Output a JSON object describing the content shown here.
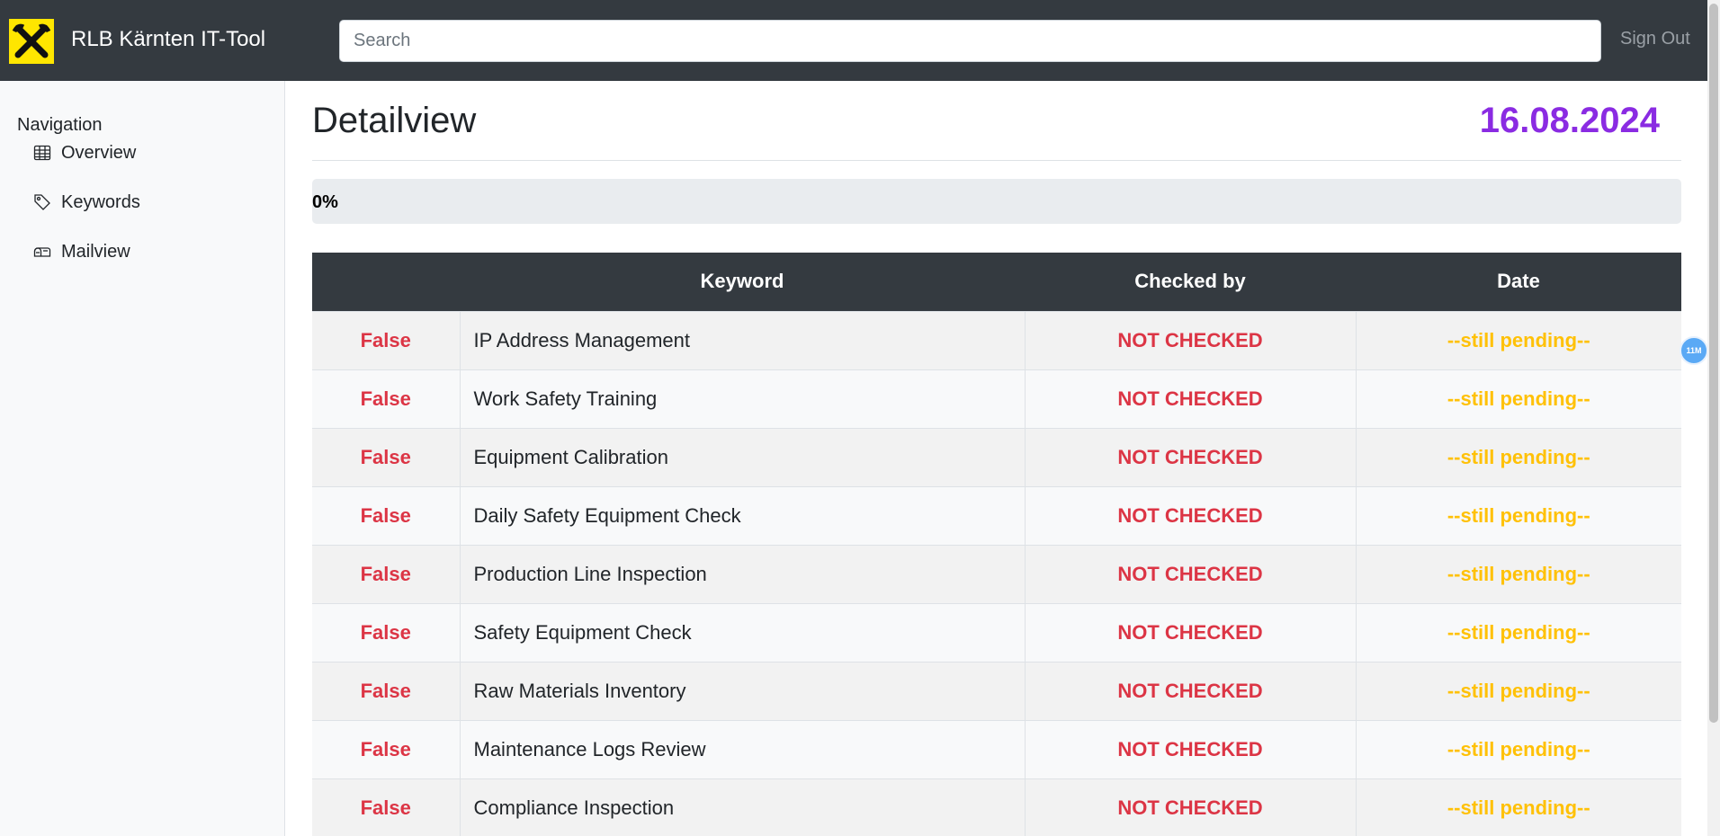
{
  "header": {
    "brand": "RLB Kärnten IT-Tool",
    "search_placeholder": "Search",
    "sign_out": "Sign Out",
    "logo_icon": "raiffeisen-logo-icon"
  },
  "sidebar": {
    "heading": "Navigation",
    "items": [
      {
        "label": "Overview",
        "icon": "table-icon"
      },
      {
        "label": "Keywords",
        "icon": "tag-icon"
      },
      {
        "label": "Mailview",
        "icon": "mailbox-icon"
      }
    ]
  },
  "main": {
    "title": "Detailview",
    "date": "16.08.2024",
    "progress": {
      "label": "0%",
      "value": 0
    },
    "table": {
      "headers": [
        "",
        "Keyword",
        "Checked by",
        "Date"
      ],
      "rows": [
        {
          "status": "False",
          "keyword": "IP Address Management",
          "checked_by": "NOT CHECKED",
          "date": "--still pending--"
        },
        {
          "status": "False",
          "keyword": "Work Safety Training",
          "checked_by": "NOT CHECKED",
          "date": "--still pending--"
        },
        {
          "status": "False",
          "keyword": "Equipment Calibration",
          "checked_by": "NOT CHECKED",
          "date": "--still pending--"
        },
        {
          "status": "False",
          "keyword": "Daily Safety Equipment Check",
          "checked_by": "NOT CHECKED",
          "date": "--still pending--"
        },
        {
          "status": "False",
          "keyword": "Production Line Inspection",
          "checked_by": "NOT CHECKED",
          "date": "--still pending--"
        },
        {
          "status": "False",
          "keyword": "Safety Equipment Check",
          "checked_by": "NOT CHECKED",
          "date": "--still pending--"
        },
        {
          "status": "False",
          "keyword": "Raw Materials Inventory",
          "checked_by": "NOT CHECKED",
          "date": "--still pending--"
        },
        {
          "status": "False",
          "keyword": "Maintenance Logs Review",
          "checked_by": "NOT CHECKED",
          "date": "--still pending--"
        },
        {
          "status": "False",
          "keyword": "Compliance Inspection",
          "checked_by": "NOT CHECKED",
          "date": "--still pending--"
        }
      ]
    }
  },
  "floating_badge": "11M",
  "colors": {
    "topbar": "#343a40",
    "logo_yellow": "#ffe600",
    "date_purple": "#8a2be2",
    "status_red": "#dc3545",
    "pending_yellow": "#ffc107"
  }
}
